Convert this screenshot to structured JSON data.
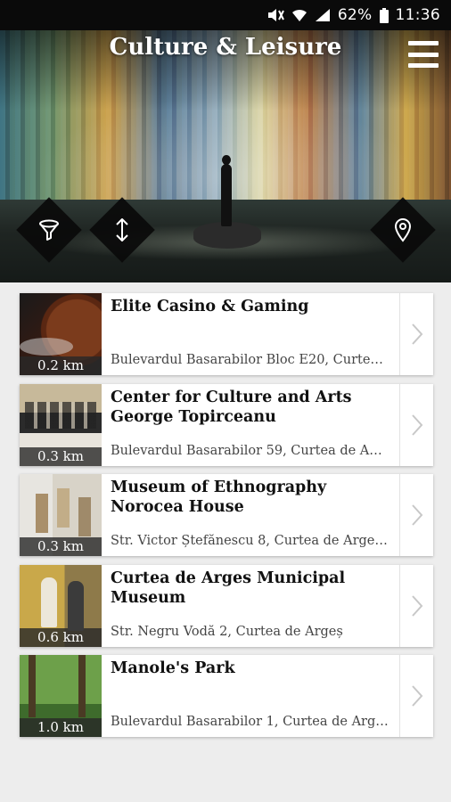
{
  "status_bar": {
    "battery": "62%",
    "time": "11:36"
  },
  "header": {
    "title": "Culture & Leisure"
  },
  "places": [
    {
      "name": "Elite Casino & Gaming",
      "address": "Bulevardul Basarabilor Bloc E20, Curte…",
      "distance": "0.2 km"
    },
    {
      "name": "Center for Culture and Arts George Topirceanu",
      "address": "Bulevardul Basarabilor 59, Curtea de A…",
      "distance": "0.3 km"
    },
    {
      "name": "Museum of Ethnography Norocea House",
      "address": "Str. Victor Ștefănescu 8, Curtea de Arge…",
      "distance": "0.3 km"
    },
    {
      "name": "Curtea de Arges Municipal Museum",
      "address": "Str. Negru Vodă 2, Curtea de Argeș",
      "distance": "0.6 km"
    },
    {
      "name": "Manole's Park",
      "address": "Bulevardul Basarabilor 1, Curtea de Arg…",
      "distance": "1.0 km"
    }
  ]
}
